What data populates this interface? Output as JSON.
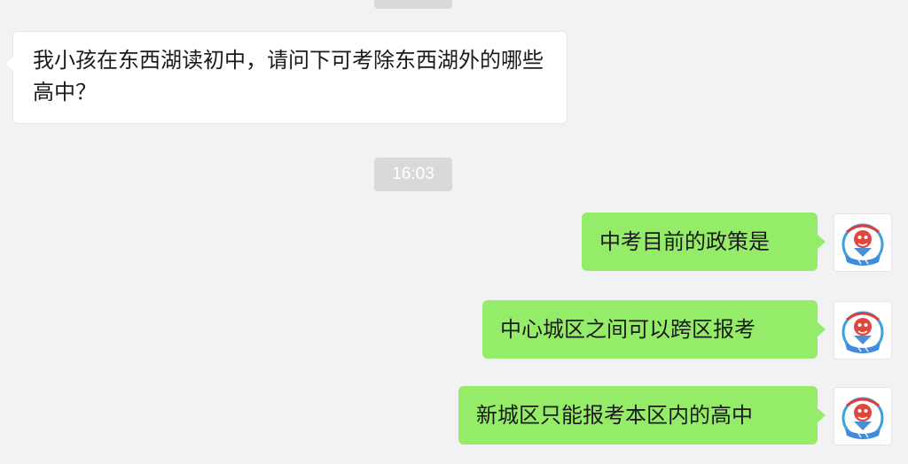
{
  "chat": {
    "messages": [
      {
        "direction": "received",
        "text": "我小孩在东西湖读初中，请问下可考除东西湖外的哪些高中？"
      },
      {
        "type": "timestamp",
        "text": "16:03"
      },
      {
        "direction": "sent",
        "text": "中考目前的政策是"
      },
      {
        "direction": "sent",
        "text": "中心城区之间可以跨区报考"
      },
      {
        "direction": "sent",
        "text": "新城区只能报考本区内的高中"
      }
    ]
  },
  "avatar": {
    "icon": "mascot-avatar-icon"
  },
  "colors": {
    "background": "#f2f2f4",
    "received_bubble": "#ffffff",
    "sent_bubble": "#95ec69",
    "timestamp_pill": "#d9d9d9"
  }
}
